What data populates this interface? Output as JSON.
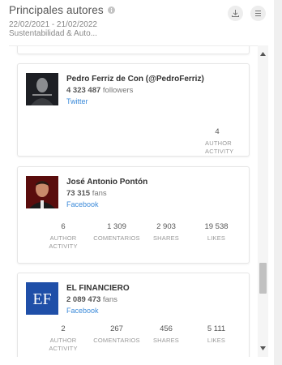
{
  "header": {
    "title": "Principales autores",
    "date_range": "22/02/2021 - 21/02/2022",
    "filter": "Sustentabilidad & Auto...",
    "icons": {
      "info": "info-icon",
      "download": "download-icon",
      "menu": "menu-icon"
    }
  },
  "authors": [
    {
      "name": "Pedro Ferriz de Con (@PedroFerriz)",
      "count": "4 323 487",
      "count_unit": "followers",
      "network": "Twitter",
      "stats": [
        {
          "value": "4",
          "label": "AUTHOR ACTIVITY"
        }
      ]
    },
    {
      "name": "José Antonio Pontón",
      "count": "73 315",
      "count_unit": "fans",
      "network": "Facebook",
      "stats": [
        {
          "value": "6",
          "label": "AUTHOR ACTIVITY"
        },
        {
          "value": "1 309",
          "label": "COMENTARIOS"
        },
        {
          "value": "2 903",
          "label": "SHARES"
        },
        {
          "value": "19 538",
          "label": "LIKES"
        }
      ]
    },
    {
      "name": "EL FINANCIERO",
      "count": "2 089 473",
      "count_unit": "fans",
      "network": "Facebook",
      "logo_text": "EF",
      "stats": [
        {
          "value": "2",
          "label": "AUTHOR ACTIVITY"
        },
        {
          "value": "267",
          "label": "COMENTARIOS"
        },
        {
          "value": "456",
          "label": "SHARES"
        },
        {
          "value": "5 111",
          "label": "LIKES"
        }
      ]
    }
  ],
  "colors": {
    "link": "#3b8ad9",
    "ef_logo_bg": "#1f4fa8"
  }
}
